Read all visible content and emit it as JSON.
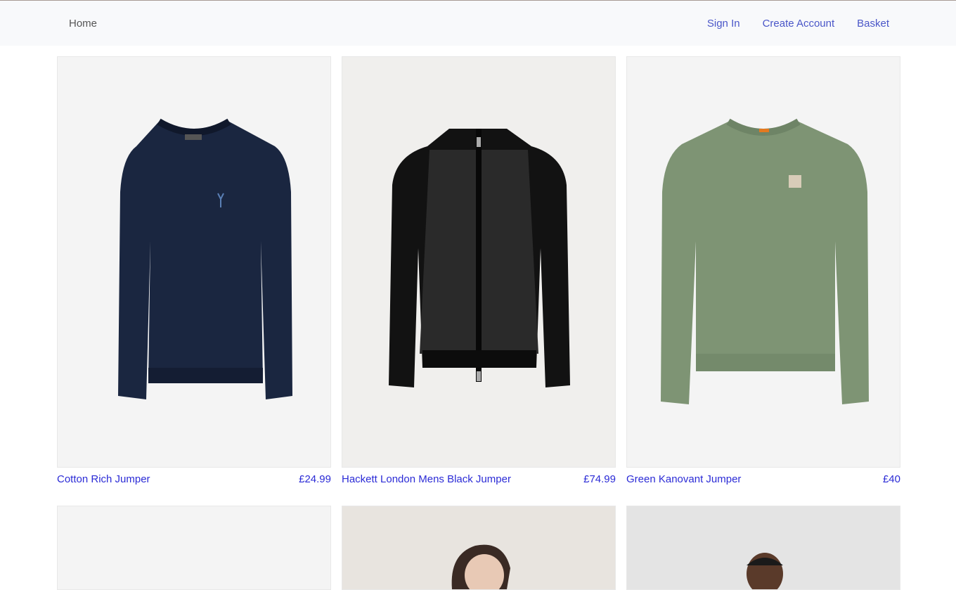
{
  "nav": {
    "home_label": "Home",
    "sign_in_label": "Sign In",
    "create_account_label": "Create Account",
    "basket_label": "Basket"
  },
  "products": [
    {
      "title": "Cotton Rich Jumper",
      "price": "£24.99",
      "color": "#1a2640"
    },
    {
      "title": "Hackett London Mens Black Jumper",
      "price": "£74.99",
      "color": "#161616"
    },
    {
      "title": "Green Kanovant Jumper",
      "price": "£40",
      "color": "#7e9474"
    }
  ],
  "colors": {
    "link": "#2b2bd6",
    "nav_link": "#4a56c8",
    "navbar_bg": "#f8f9fb"
  }
}
